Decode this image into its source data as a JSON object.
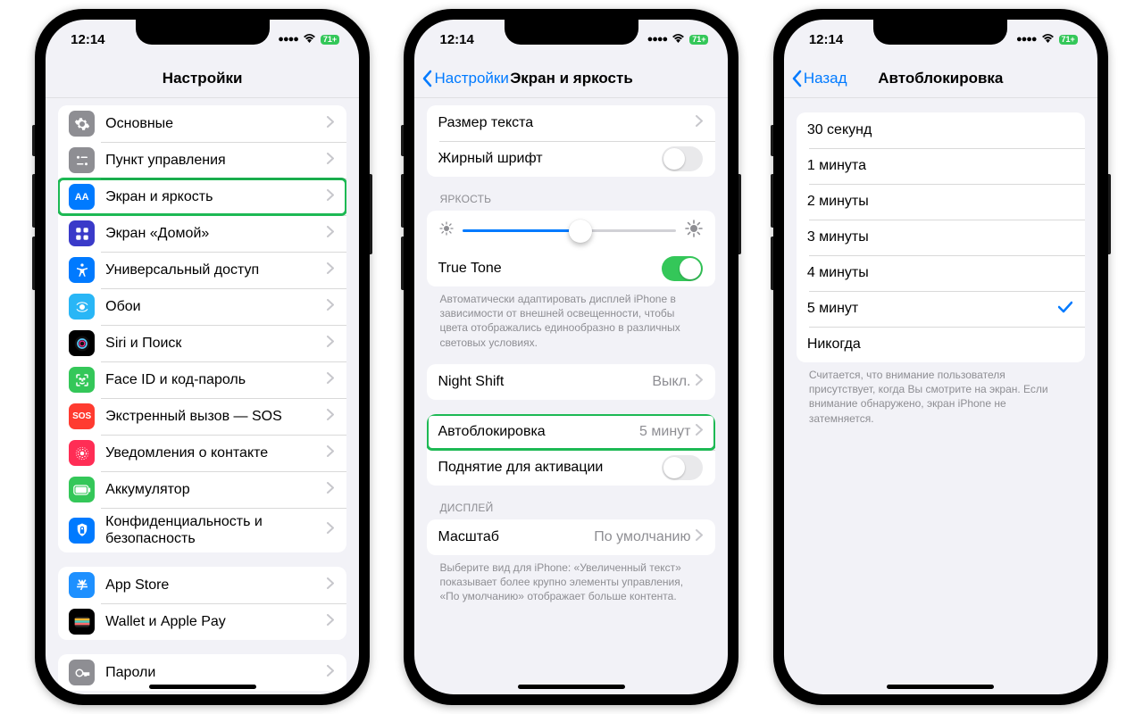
{
  "status": {
    "time": "12:14",
    "battery": "71+"
  },
  "colors": {
    "general": "#8e8e93",
    "control": "#8e8e93",
    "display": "#007aff",
    "home": "#3a3ac9",
    "accessibility": "#007aff",
    "wallpaper": "#29b6f6",
    "siri": "#000",
    "faceid": "#34c759",
    "sos": "#ff3b30",
    "exposure": "#ff2d55",
    "battery": "#34c759",
    "privacy": "#007aff",
    "appstore": "#1e90ff",
    "wallet": "#000",
    "passwords": "#8e8e93"
  },
  "phone1": {
    "title": "Настройки",
    "items": [
      {
        "key": "general",
        "label": "Основные"
      },
      {
        "key": "control",
        "label": "Пункт управления"
      },
      {
        "key": "display",
        "label": "Экран и яркость",
        "highlight": true
      },
      {
        "key": "home",
        "label": "Экран «Домой»"
      },
      {
        "key": "accessibility",
        "label": "Универсальный доступ"
      },
      {
        "key": "wallpaper",
        "label": "Обои"
      },
      {
        "key": "siri",
        "label": "Siri и Поиск"
      },
      {
        "key": "faceid",
        "label": "Face ID и код-пароль"
      },
      {
        "key": "sos",
        "label": "Экстренный вызов — SOS"
      },
      {
        "key": "exposure",
        "label": "Уведомления о контакте"
      },
      {
        "key": "battery",
        "label": "Аккумулятор"
      },
      {
        "key": "privacy",
        "label": "Конфиденциальность и безопасность"
      }
    ],
    "items2": [
      {
        "key": "appstore",
        "label": "App Store"
      },
      {
        "key": "wallet",
        "label": "Wallet и Apple Pay"
      }
    ],
    "items3": [
      {
        "key": "passwords",
        "label": "Пароли"
      }
    ]
  },
  "phone2": {
    "back": "Настройки",
    "title": "Экран и яркость",
    "text_size": "Размер текста",
    "bold_text": "Жирный шрифт",
    "brightness_header": "ЯРКОСТЬ",
    "slider_percent": 55,
    "truetone": "True Tone",
    "truetone_footer": "Автоматически адаптировать дисплей iPhone в зависимости от внешней освещенности, чтобы цвета отображались единообразно в различных световых условиях.",
    "night_shift": "Night Shift",
    "night_shift_value": "Выкл.",
    "autolock": "Автоблокировка",
    "autolock_value": "5 минут",
    "raise": "Поднятие для активации",
    "display_header": "ДИСПЛЕЙ",
    "zoom": "Масштаб",
    "zoom_value": "По умолчанию",
    "zoom_footer": "Выберите вид для iPhone: «Увеличенный текст» показывает более крупно элементы управления, «По умолчанию» отображает больше контента."
  },
  "phone3": {
    "back": "Назад",
    "title": "Автоблокировка",
    "options": [
      "30 секунд",
      "1 минута",
      "2 минуты",
      "3 минуты",
      "4 минуты",
      "5 минут",
      "Никогда"
    ],
    "selected_index": 5,
    "footer": "Считается, что внимание пользователя присутствует, когда Вы смотрите на экран. Если внимание обнаружено, экран iPhone не затемняется."
  }
}
